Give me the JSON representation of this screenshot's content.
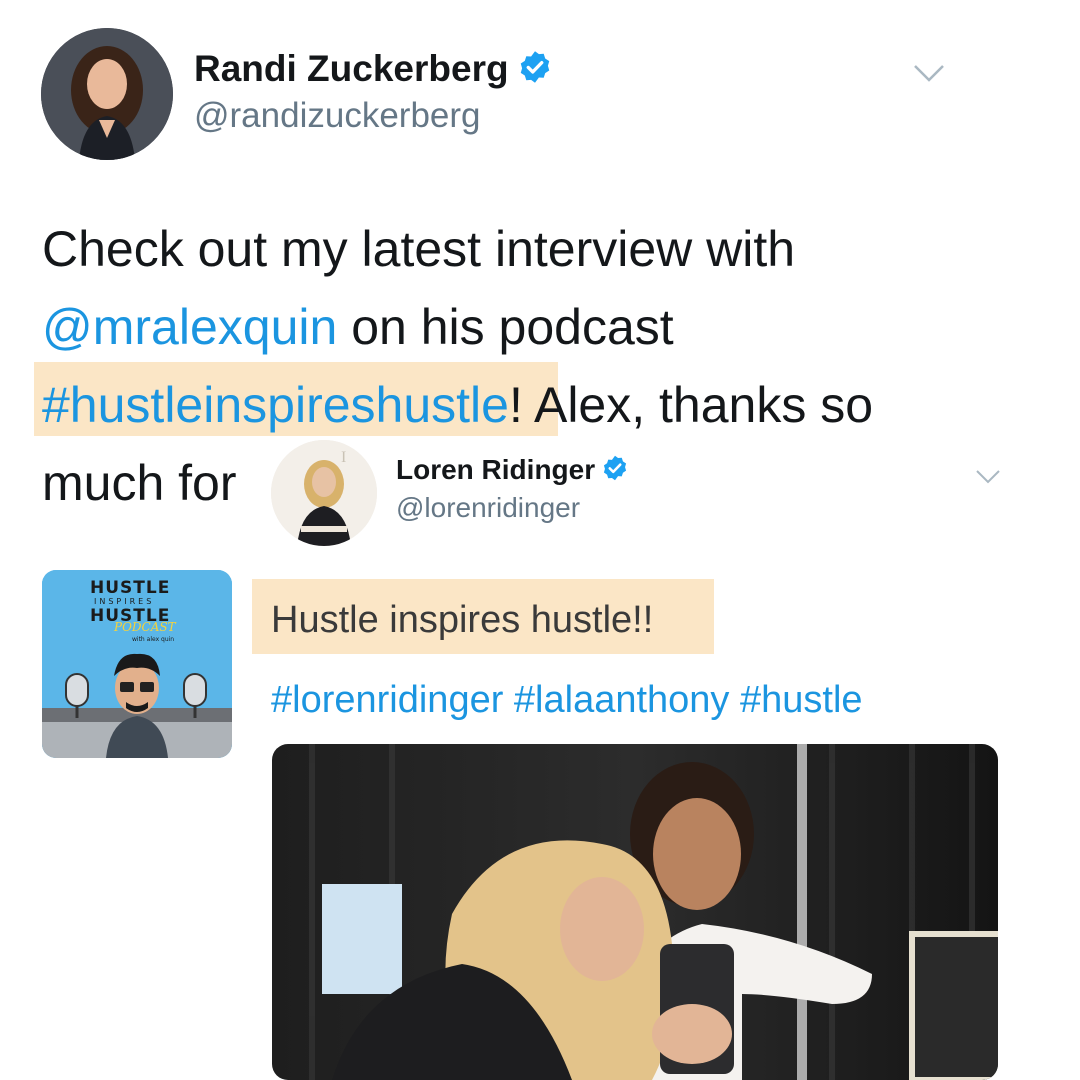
{
  "main_tweet": {
    "author_name": "Randi Zuckerberg",
    "author_handle": "@randizuckerberg",
    "text_line1": "Check out my latest interview with",
    "mention": "@mralexquin",
    "text_line2_rest": " on his podcast",
    "hashtag": "#hustleinspireshustle",
    "text_line3_rest": "! Alex, thanks so",
    "text_line4": "much for"
  },
  "embedded_tweet": {
    "author_name": "Loren Ridinger",
    "author_handle": "@lorenridinger",
    "text": "Hustle inspires hustle!!",
    "hashtags": "#lorenridinger #lalaanthony #hustle"
  },
  "podcast_art": {
    "title_top": "HUSTLE",
    "title_middle": "INSPIRES",
    "title_bottom": "HUSTLE",
    "script_word": "PODCAST",
    "byline": "with alex quin"
  },
  "colors": {
    "link": "#1b95e0",
    "verified": "#1da1f2",
    "highlight": "#fbe6c6",
    "handle": "#657786"
  },
  "icons": [
    "verified-badge-icon",
    "chevron-down-icon"
  ]
}
